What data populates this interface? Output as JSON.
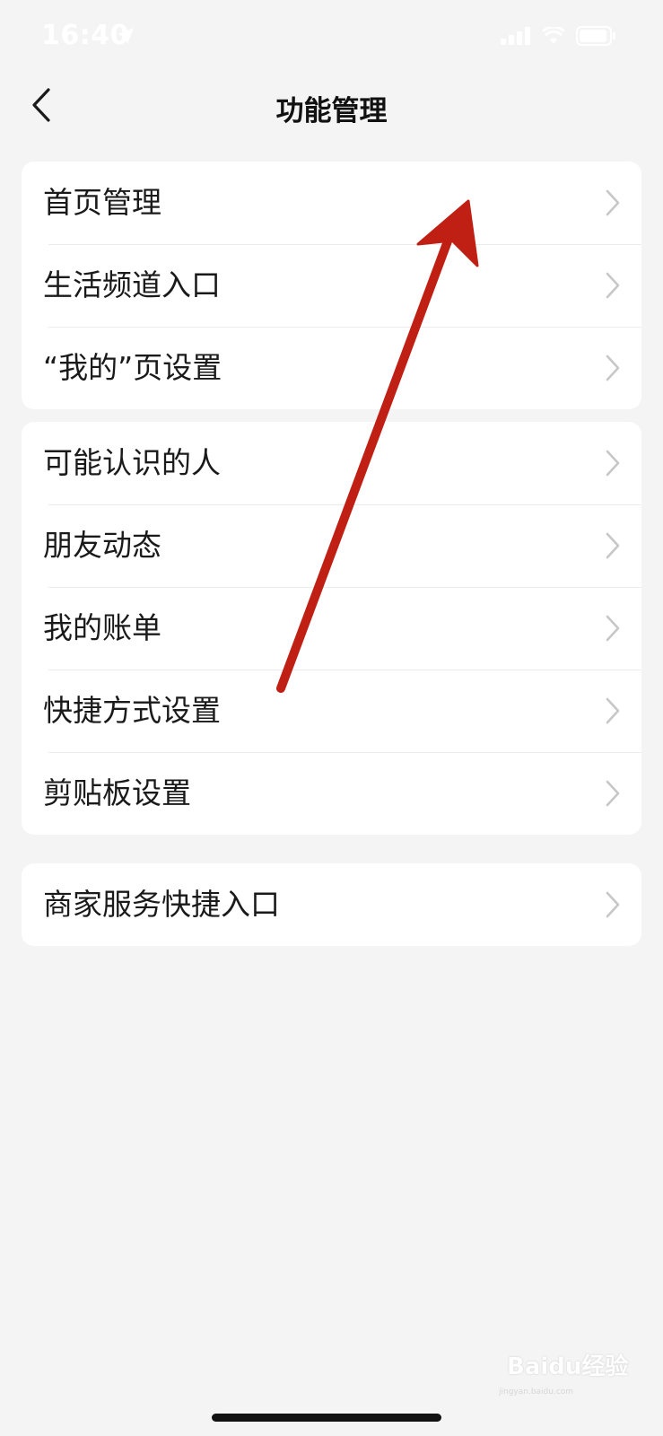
{
  "status_bar": {
    "time": "16:40",
    "icons": [
      "location-arrow-icon",
      "signal-bars-icon",
      "wifi-icon",
      "battery-icon"
    ]
  },
  "nav": {
    "title": "功能管理",
    "back_icon": "chevron-left-icon"
  },
  "groups": [
    {
      "items": [
        {
          "label": "首页管理"
        },
        {
          "label": "生活频道入口"
        },
        {
          "label": "“我的”页设置"
        }
      ]
    },
    {
      "items": [
        {
          "label": "可能认识的人"
        },
        {
          "label": "朋友动态"
        },
        {
          "label": "我的账单"
        },
        {
          "label": "快捷方式设置"
        },
        {
          "label": "剪贴板设置"
        }
      ]
    },
    {
      "items": [
        {
          "label": "商家服务快捷入口"
        }
      ]
    }
  ],
  "row_icon": "chevron-right-icon",
  "annotation": {
    "color": "#c01f14",
    "icon": "red-arrow-annotation"
  },
  "watermark": {
    "text": "Baidu经验",
    "sub": "jingyan.baidu.com"
  },
  "colors": {
    "background": "#f4f4f4",
    "card": "#ffffff",
    "chevron": "#c7c7c7",
    "divider": "#ececec"
  }
}
